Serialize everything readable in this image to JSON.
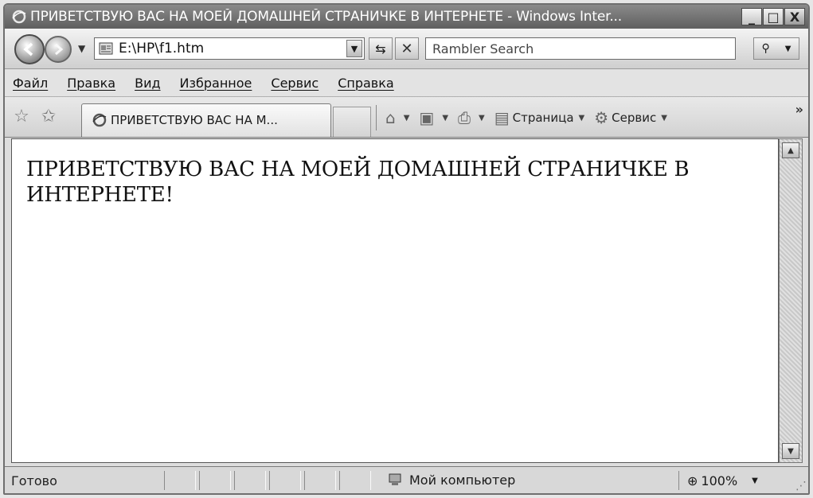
{
  "window": {
    "title": "ПРИВЕТСТВУЮ ВАС НА МОЕЙ ДОМАШНЕЙ СТРАНИЧКЕ В ИНТЕРНЕТЕ - Windows Inter...",
    "icon": "ie-icon",
    "controls": {
      "minimize": "_",
      "maximize": "□",
      "close": "X"
    }
  },
  "address_bar": {
    "url": "E:\\HP\\f1.htm",
    "favicon": "page-icon"
  },
  "search": {
    "placeholder": "Rambler Search"
  },
  "menu": {
    "items": [
      "Файл",
      "Правка",
      "Вид",
      "Избранное",
      "Сервис",
      "Справка"
    ]
  },
  "command_bar": {
    "tab_label": "ПРИВЕТСТВУЮ ВАС НА М...",
    "tools": [
      {
        "icon": "home-icon",
        "label": ""
      },
      {
        "icon": "feeds-icon",
        "label": ""
      },
      {
        "icon": "print-icon",
        "label": ""
      },
      {
        "icon": "page-menu-icon",
        "label": "Страница"
      },
      {
        "icon": "tools-gear-icon",
        "label": "Сервис"
      }
    ],
    "more": "»"
  },
  "page": {
    "heading": "ПРИВЕТСТВУЮ ВАС НА МОЕЙ ДОМАШНЕЙ СТРАНИЧКЕ В ИНТЕРНЕТЕ!"
  },
  "status_bar": {
    "status": "Готово",
    "zone": "Мой компьютер",
    "zoom": "100%"
  }
}
